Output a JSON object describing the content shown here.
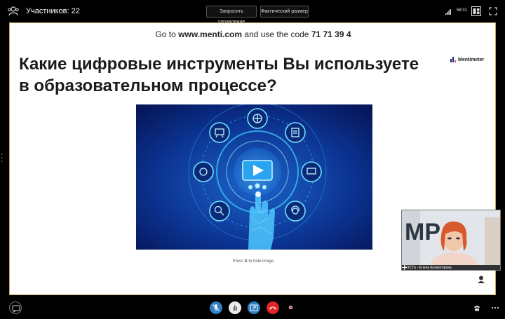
{
  "topbar": {
    "participants_label": "Участников: 22",
    "request_control_label": "Запросить управление",
    "actual_size_label": "Фактический размер",
    "clock": "58:31"
  },
  "slide": {
    "url_prefix": "Go to ",
    "url": "www.menti.com",
    "url_mid": " and use the code ",
    "code": "71 71 39 4",
    "logo_text": "Mentimeter",
    "question": "Какие цифровые инструменты Вы используете в образовательном процессе?",
    "hint_prefix": "Press ",
    "hint_key": "S",
    "hint_suffix": " to hide image"
  },
  "video": {
    "name": "ГОСТЬ - Елена Колмогорова",
    "wall_letters": "MP"
  },
  "icons": {
    "participants": "participants-icon",
    "signal": "signal-icon",
    "layout": "layout-icon",
    "fullscreen": "fullscreen-icon",
    "chat": "chat-icon",
    "mic": "mic-muted-icon",
    "hand": "raise-hand-icon",
    "share": "share-screen-icon",
    "hangup": "hang-up-icon",
    "record": "record-icon",
    "phone": "phone-icon",
    "more": "more-icon"
  },
  "colors": {
    "slide_border": "#c8a94a",
    "primary_button": "#2f7fc1",
    "hangup": "#e0262a",
    "image_bg": "#0a2a78",
    "image_glow": "#3fd0ff"
  }
}
